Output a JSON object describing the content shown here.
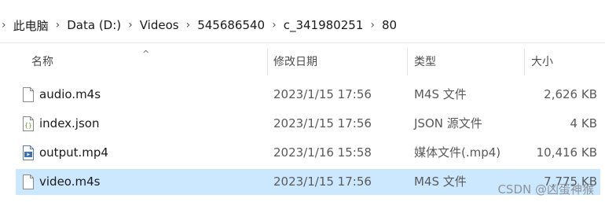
{
  "address": {
    "sep": "›",
    "crumbs": [
      "此电脑",
      "Data (D:)",
      "Videos",
      "545686540",
      "c_341980251",
      "80"
    ]
  },
  "columns": {
    "name": "名称",
    "date": "修改日期",
    "type": "类型",
    "size": "大小"
  },
  "files": [
    {
      "name": "audio.m4s",
      "date": "2023/1/15 17:56",
      "type": "M4S 文件",
      "size": "2,626 KB",
      "icon": "document-icon"
    },
    {
      "name": "index.json",
      "date": "2023/1/15 17:56",
      "type": "JSON 源文件",
      "size": "4 KB",
      "icon": "json-file-icon"
    },
    {
      "name": "output.mp4",
      "date": "2023/1/16 15:58",
      "type": "媒体文件(.mp4)",
      "size": "10,416 KB",
      "icon": "video-file-icon"
    },
    {
      "name": "video.m4s",
      "date": "2023/1/15 17:56",
      "type": "M4S 文件",
      "size": "7,775 KB",
      "icon": "document-icon",
      "selected": true
    }
  ],
  "watermark": "CSDN @凶蛋神猴",
  "colors": {
    "selected_row": "#cce8ff"
  }
}
